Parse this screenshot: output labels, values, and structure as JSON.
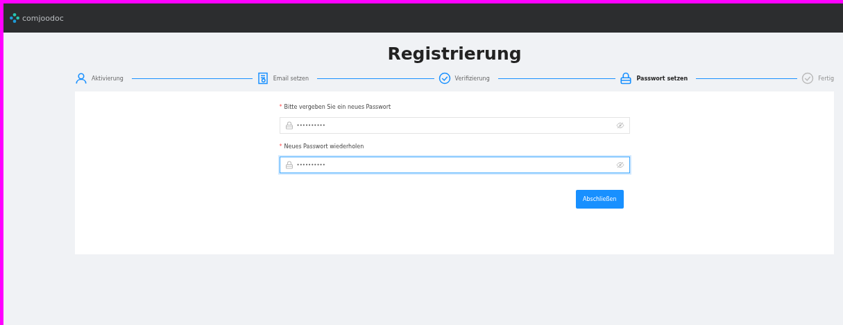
{
  "header": {
    "brand": "comjoodoc"
  },
  "title": "Registrierung",
  "steps": [
    {
      "label": "Aktivierung",
      "kind": "user",
      "finished": true,
      "selected": false
    },
    {
      "label": "Email setzen",
      "kind": "document",
      "finished": true,
      "selected": false
    },
    {
      "label": "Verifizierung",
      "kind": "check",
      "finished": true,
      "selected": false
    },
    {
      "label": "Passwort setzen",
      "kind": "lock",
      "finished": false,
      "selected": true
    },
    {
      "label": "Fertig",
      "kind": "check",
      "finished": false,
      "selected": false
    }
  ],
  "form": {
    "fields": [
      {
        "label": "Bitte vergeben Sie ein neues Passwort",
        "marker": "*",
        "value": "••••••••••",
        "focused": false
      },
      {
        "label": "Neues Passwort wiederholen",
        "marker": "*",
        "value": "••••••••••",
        "focused": true
      }
    ],
    "submit": "Abschließen"
  }
}
